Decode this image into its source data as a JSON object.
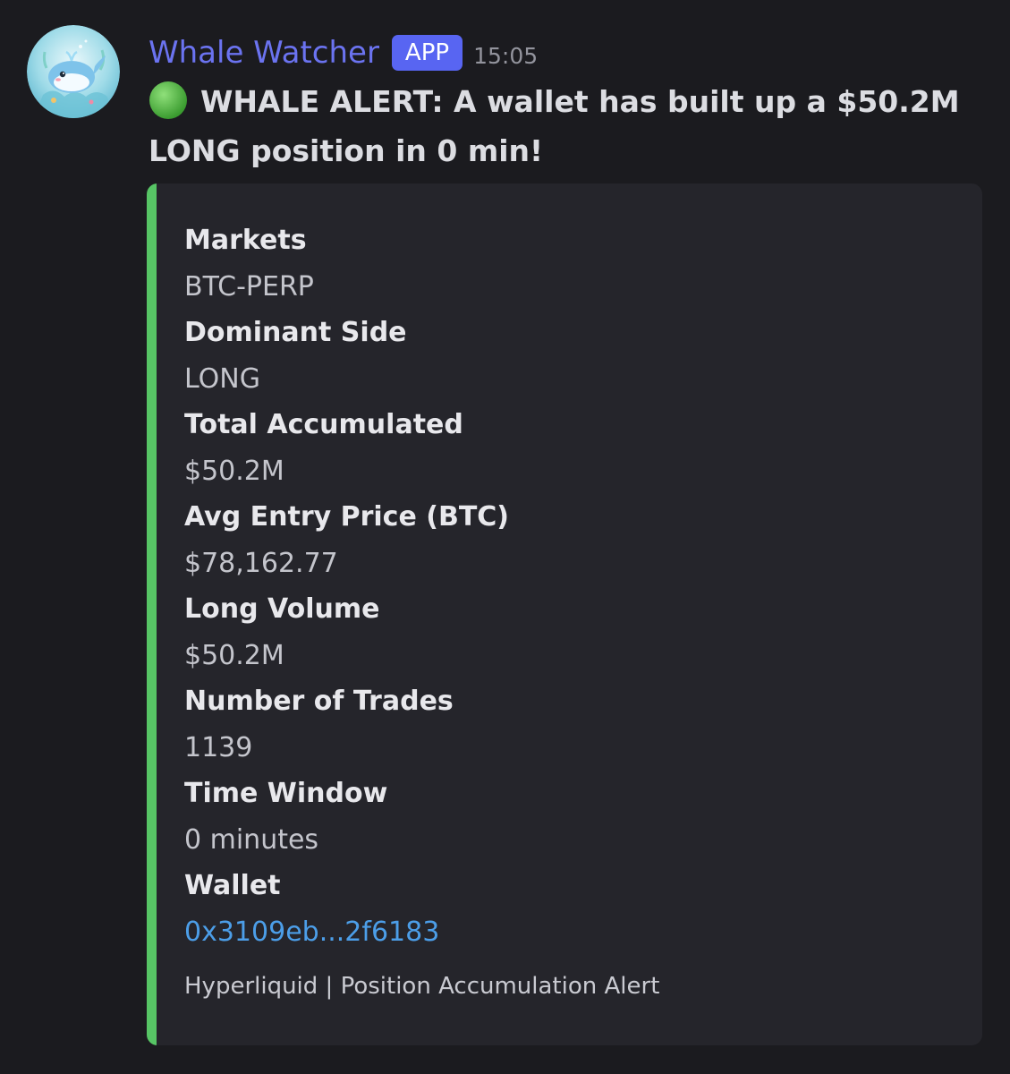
{
  "message": {
    "author": "Whale Watcher",
    "badge": "APP",
    "timestamp": "15:05",
    "alert_text": "WHALE ALERT: A wallet has built up a $50.2M LONG position in 0 min!",
    "alert_icon": "green-circle-emoji"
  },
  "embed": {
    "accent_color": "#57c565",
    "fields": [
      {
        "name": "Markets",
        "value": "BTC-PERP"
      },
      {
        "name": "Dominant Side",
        "value": "LONG"
      },
      {
        "name": "Total Accumulated",
        "value": "$50.2M"
      },
      {
        "name": "Avg Entry Price (BTC)",
        "value": "$78,162.77"
      },
      {
        "name": "Long Volume",
        "value": "$50.2M"
      },
      {
        "name": "Number of Trades",
        "value": "1139"
      },
      {
        "name": "Time Window",
        "value": "0 minutes"
      },
      {
        "name": "Wallet",
        "value": "0x3109eb...2f6183"
      }
    ],
    "footer": "Hyperliquid | Position Accumulation Alert"
  },
  "colors": {
    "background": "#1b1b1f",
    "username": "#6b73f0",
    "badge": "#5865f2",
    "link": "#4c9ee8"
  }
}
